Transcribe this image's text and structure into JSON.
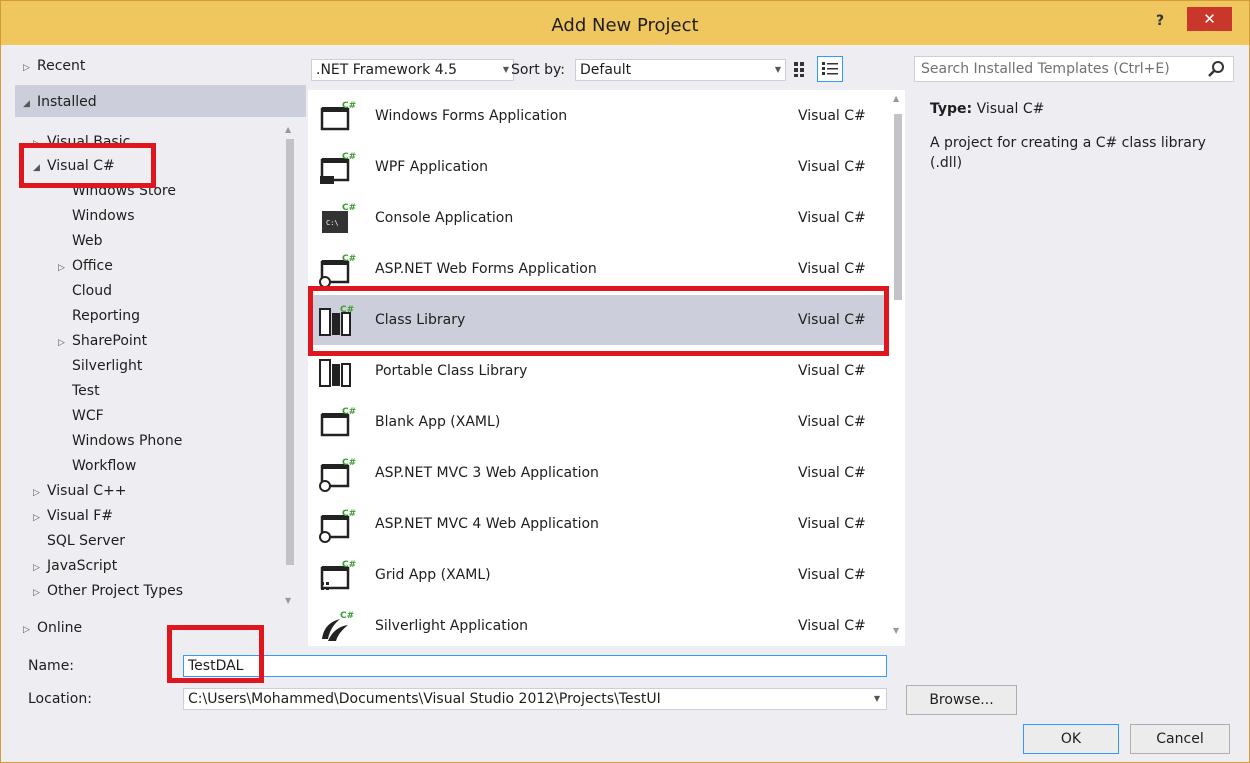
{
  "window": {
    "title": "Add New Project",
    "help": "?",
    "close": "✕"
  },
  "tree": {
    "recent": "Recent",
    "installed": "Installed",
    "visual_basic": "Visual Basic",
    "visual_csharp": "Visual C#",
    "csharp_children": [
      "Windows Store",
      "Windows",
      "Web",
      "Office",
      "Cloud",
      "Reporting",
      "SharePoint",
      "Silverlight",
      "Test",
      "WCF",
      "Windows Phone",
      "Workflow"
    ],
    "others": [
      "Visual C++",
      "Visual F#",
      "SQL Server",
      "JavaScript",
      "Other Project Types"
    ],
    "online": "Online"
  },
  "toolbar": {
    "framework": ".NET Framework 4.5",
    "sort_label": "Sort by:",
    "sort_value": "Default"
  },
  "templates": [
    {
      "name": "Windows Forms Application",
      "lang": "Visual C#",
      "icon": "winforms-icon"
    },
    {
      "name": "WPF Application",
      "lang": "Visual C#",
      "icon": "wpf-icon"
    },
    {
      "name": "Console Application",
      "lang": "Visual C#",
      "icon": "console-icon"
    },
    {
      "name": "ASP.NET Web Forms Application",
      "lang": "Visual C#",
      "icon": "webforms-icon"
    },
    {
      "name": "Class Library",
      "lang": "Visual C#",
      "icon": "class-library-icon"
    },
    {
      "name": "Portable Class Library",
      "lang": "Visual C#",
      "icon": "portable-library-icon"
    },
    {
      "name": "Blank App (XAML)",
      "lang": "Visual C#",
      "icon": "blank-app-icon"
    },
    {
      "name": "ASP.NET MVC 3 Web Application",
      "lang": "Visual C#",
      "icon": "mvc3-icon"
    },
    {
      "name": "ASP.NET MVC 4 Web Application",
      "lang": "Visual C#",
      "icon": "mvc4-icon"
    },
    {
      "name": "Grid App (XAML)",
      "lang": "Visual C#",
      "icon": "grid-app-icon"
    },
    {
      "name": "Silverlight Application",
      "lang": "Visual C#",
      "icon": "silverlight-icon"
    }
  ],
  "search": {
    "placeholder": "Search Installed Templates (Ctrl+E)"
  },
  "info": {
    "type_label": "Type:",
    "type_value": "Visual C#",
    "description": "A project for creating a C# class library (.dll)"
  },
  "form": {
    "name_label": "Name:",
    "name_value": "TestDAL",
    "location_label": "Location:",
    "location_value": "C:\\Users\\Mohammed\\Documents\\Visual Studio 2012\\Projects\\TestUI",
    "browse": "Browse...",
    "ok": "OK",
    "cancel": "Cancel"
  }
}
